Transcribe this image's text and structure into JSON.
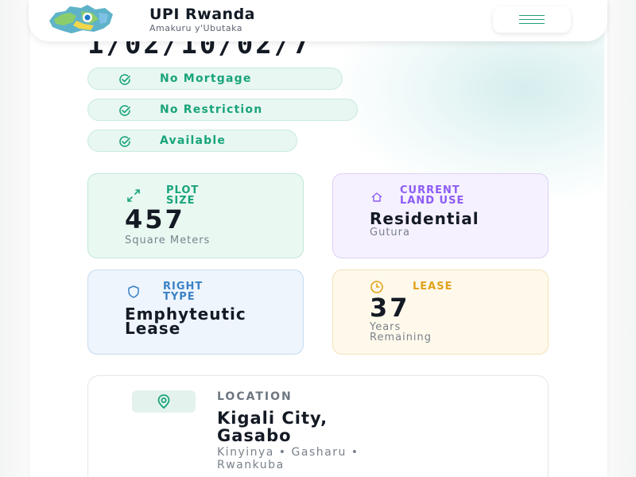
{
  "header": {
    "title": "UPI Rwanda",
    "subtitle": "Amakuru y'Ubutaka"
  },
  "plot": {
    "id_partial": "1/02/10/02/7"
  },
  "status_pills": [
    {
      "label": "No Mortgage"
    },
    {
      "label": "No Restriction"
    },
    {
      "label": "Available"
    }
  ],
  "tiles": {
    "plot_size": {
      "label_line1": "PLOT",
      "label_line2": "SIZE",
      "value": "457",
      "unit": "Square Meters"
    },
    "land_use": {
      "label_line1": "CURRENT",
      "label_line2": "LAND USE",
      "value": "Residential",
      "sub": "Gutura"
    },
    "right_type": {
      "label_line1": "RIGHT",
      "label_line2": "TYPE",
      "value_line1": "Emphyteutic",
      "value_line2": "Lease"
    },
    "lease": {
      "label": "LEASE",
      "value": "37",
      "sub_line1": "Years",
      "sub_line2": "Remaining"
    }
  },
  "location": {
    "label": "LOCATION",
    "city_line1": "Kigali City,",
    "city_line2": "Gasabo",
    "detail_line1": "Kinyinya • Gasharu •",
    "detail_line2": "Rwankuba"
  },
  "icons": {
    "logo": "rwanda-map-logo",
    "menu": "hamburger-icon",
    "check": "circle-check-icon",
    "plot_size": "expand-arrows-icon",
    "land_use": "home-icon",
    "right_type": "shield-icon",
    "lease": "clock-icon",
    "location": "map-pin-icon"
  },
  "colors": {
    "accent_green": "#19a47b",
    "accent_purple": "#8b5cf6",
    "accent_blue": "#3b82c4",
    "accent_amber": "#e0a21a"
  }
}
